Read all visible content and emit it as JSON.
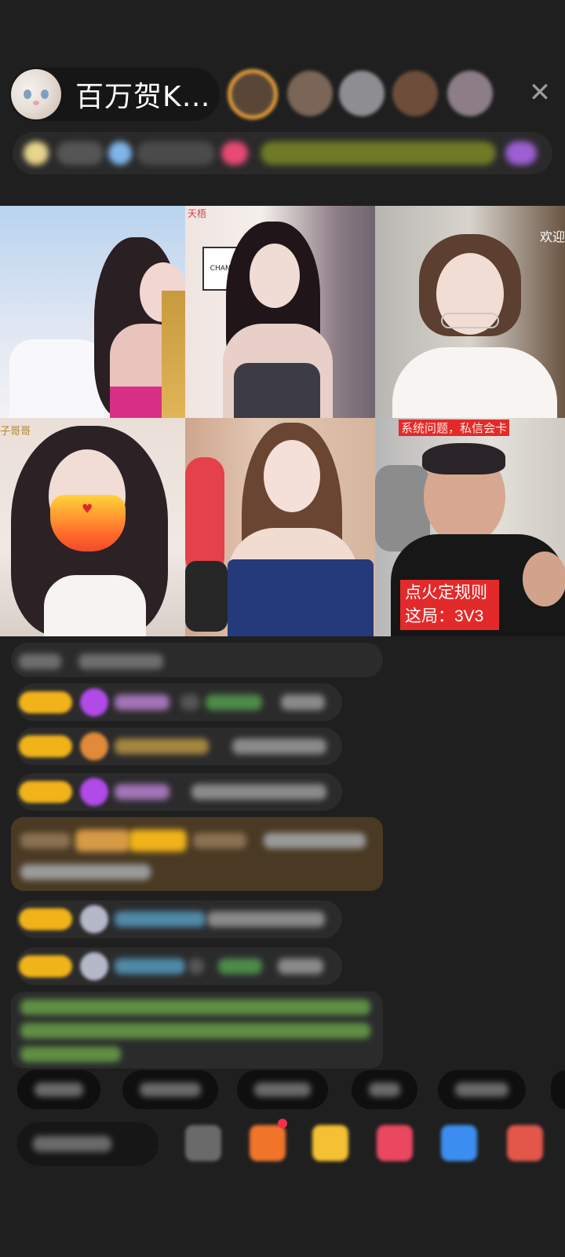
{
  "header": {
    "host_name": "百万贺K…",
    "close_icon_text": "✕"
  },
  "videos": {
    "cell_1_tag": "天梧",
    "cell_2_logo": "CHANEL",
    "cell_3_caption": "欢迎",
    "cell_4_caption": "子哥哥",
    "cell_6_notice": "系统问题，私信会卡",
    "cell_6_rule_line1": "点火定规则",
    "cell_6_rule_line2": "这局：3V3"
  },
  "colors": {
    "accent_gold": "#f0b31a",
    "overlay_red": "#e32a2a",
    "chat_green": "#8bdc5c",
    "chat_purple": "#b14ae8"
  }
}
